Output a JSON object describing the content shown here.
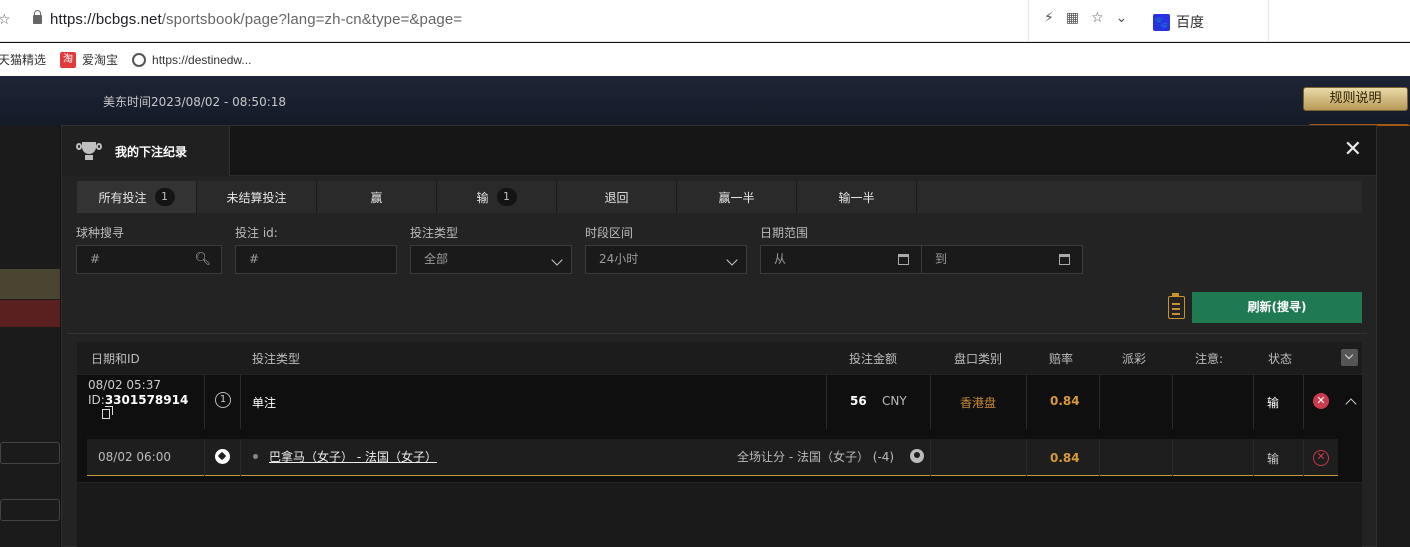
{
  "browser": {
    "url_main": "https://bcbgs.net",
    "url_rest": "/sportsbook/page?lang=zh-cn&type=&page=",
    "search_engine": "百度",
    "bookmarks": [
      {
        "label": "天猫精选",
        "icon": "tmall-icon"
      },
      {
        "label": "爱淘宝",
        "icon": "taobao-icon"
      },
      {
        "label": "https://destinedw...",
        "icon": "globe-icon"
      }
    ]
  },
  "site": {
    "time": "美东时间2023/08/02 - 08:50:18",
    "rules_label": "规则说明"
  },
  "modal": {
    "title": "我的下注纪录",
    "close": "✕",
    "tabs": [
      {
        "label": "所有投注",
        "count": "1",
        "active": true
      },
      {
        "label": "未结算投注",
        "count": ""
      },
      {
        "label": "赢",
        "count": ""
      },
      {
        "label": "输",
        "count": "1"
      },
      {
        "label": "退回",
        "count": ""
      },
      {
        "label": "赢一半",
        "count": ""
      },
      {
        "label": "输一半",
        "count": ""
      }
    ],
    "filters": {
      "sport_label": "球种搜寻",
      "sport_placeholder": "#",
      "betid_label": "投注 id:",
      "betid_placeholder": "#",
      "bettype_label": "投注类型",
      "bettype_value": "全部",
      "period_label": "时段区间",
      "period_value": "24小时",
      "date_label": "日期范围",
      "date_from": "从",
      "date_to": "到"
    },
    "refresh_label": "刷新(搜寻)",
    "table": {
      "headers": [
        "日期和ID",
        "投注类型",
        "投注金额",
        "盘口类别",
        "赔率",
        "派彩",
        "注意:",
        "状态"
      ],
      "bet": {
        "datetime": "08/02 05:37",
        "id_prefix": "ID:",
        "id": "3301578914",
        "legs": "1",
        "type": "单注",
        "amount": "56",
        "currency": "CNY",
        "market": "香港盘",
        "odds": "0.84",
        "status": "输",
        "status_icon": "✕"
      },
      "leg": {
        "datetime": "08/02 06:00",
        "sport_icon": "soccer-ball-icon",
        "match": "巴拿马（女子） - 法国（女子）",
        "selection": "全场让分 - 法国（女子） (-4)",
        "odds": "0.84",
        "status": "输",
        "status_icon": "✕"
      }
    }
  }
}
